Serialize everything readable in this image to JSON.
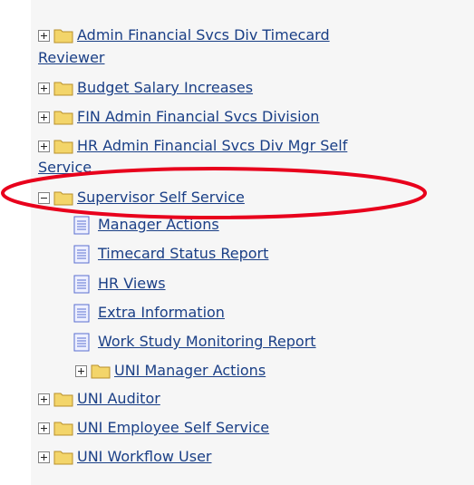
{
  "tree": {
    "admin_financial_line1": "Admin Financial Svcs Div Timecard",
    "admin_financial_line2": "Reviewer",
    "budget_salary": "Budget Salary Increases",
    "fin_admin": "FIN Admin Financial Svcs Division",
    "hr_admin_line1": "HR Admin Financial Svcs Div Mgr Self",
    "hr_admin_line2": "Service",
    "supervisor": "Supervisor Self Service",
    "manager_actions": "Manager Actions",
    "timecard_status": "Timecard Status Report",
    "hr_views": "HR Views",
    "extra_info": "Extra Information",
    "work_study": "Work Study Monitoring Report",
    "uni_manager_actions": "UNI Manager Actions",
    "uni_auditor": "UNI Auditor",
    "uni_employee": "UNI Employee Self Service",
    "uni_workflow": "UNI Workflow User"
  },
  "colors": {
    "link": "#1a3f86",
    "highlight": "#e8001c",
    "folder": "#f3d56a"
  }
}
